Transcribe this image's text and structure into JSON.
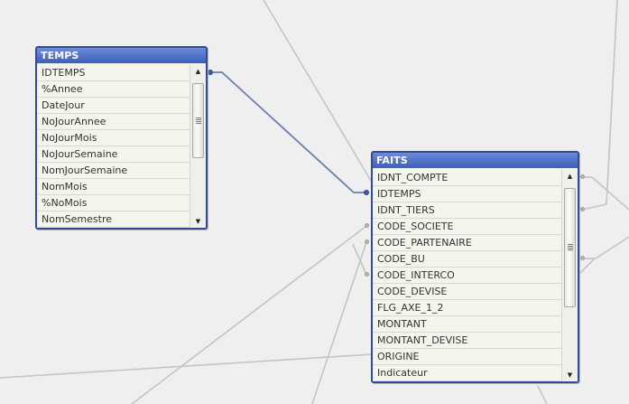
{
  "tables": {
    "temps": {
      "title": "TEMPS",
      "fields": [
        "IDTEMPS",
        "%Annee",
        "DateJour",
        "NoJourAnnee",
        "NoJourMois",
        "NoJourSemaine",
        "NomJourSemaine",
        "NomMois",
        "%NoMois",
        "NomSemestre"
      ]
    },
    "faits": {
      "title": "FAITS",
      "fields": [
        "IDNT_COMPTE",
        "IDTEMPS",
        "IDNT_TIERS",
        "CODE_SOCIETE",
        "CODE_PARTENAIRE",
        "CODE_BU",
        "CODE_INTERCO",
        "CODE_DEVISE",
        "FLG_AXE_1_2",
        "MONTANT",
        "MONTANT_DEVISE",
        "ORIGINE",
        "Indicateur"
      ]
    }
  },
  "icons": {
    "scroll_up": "scroll-up-arrow-icon",
    "scroll_down": "scroll-down-arrow-icon",
    "thumb_grip": "grip-icon"
  },
  "colors": {
    "title_bar": "#3c5fba",
    "border": "#2f4c9c",
    "link_active": "#6b7fb0",
    "link_inactive": "#c4c4c4"
  }
}
